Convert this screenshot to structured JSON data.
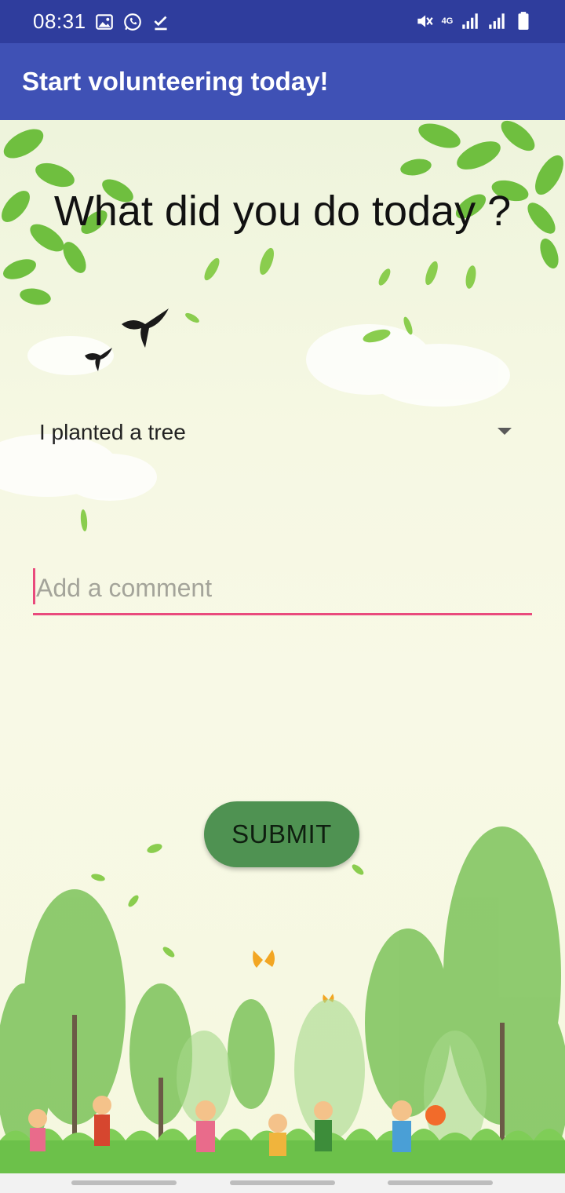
{
  "status_bar": {
    "time": "08:31",
    "left_icons": [
      "image-icon",
      "whatsapp-icon",
      "download-done-icon"
    ],
    "right_icons": [
      "mute-icon",
      "network-4g-icon",
      "signal-icon",
      "signal-icon",
      "battery-icon"
    ],
    "network_label": "4G",
    "color": "#2f3d9d"
  },
  "app_bar": {
    "title": "Start volunteering today!",
    "color": "#3f51b5"
  },
  "main": {
    "question": "What did you do today ?",
    "activity_spinner": {
      "selected": "I planted a tree"
    },
    "comment": {
      "placeholder": "Add a comment",
      "value": "",
      "accent": "#e94a7c"
    },
    "submit_label": "SUBMIT",
    "submit_color": "#4f9252"
  },
  "nav_bar": {
    "items": [
      "recent-apps",
      "home",
      "back"
    ]
  }
}
